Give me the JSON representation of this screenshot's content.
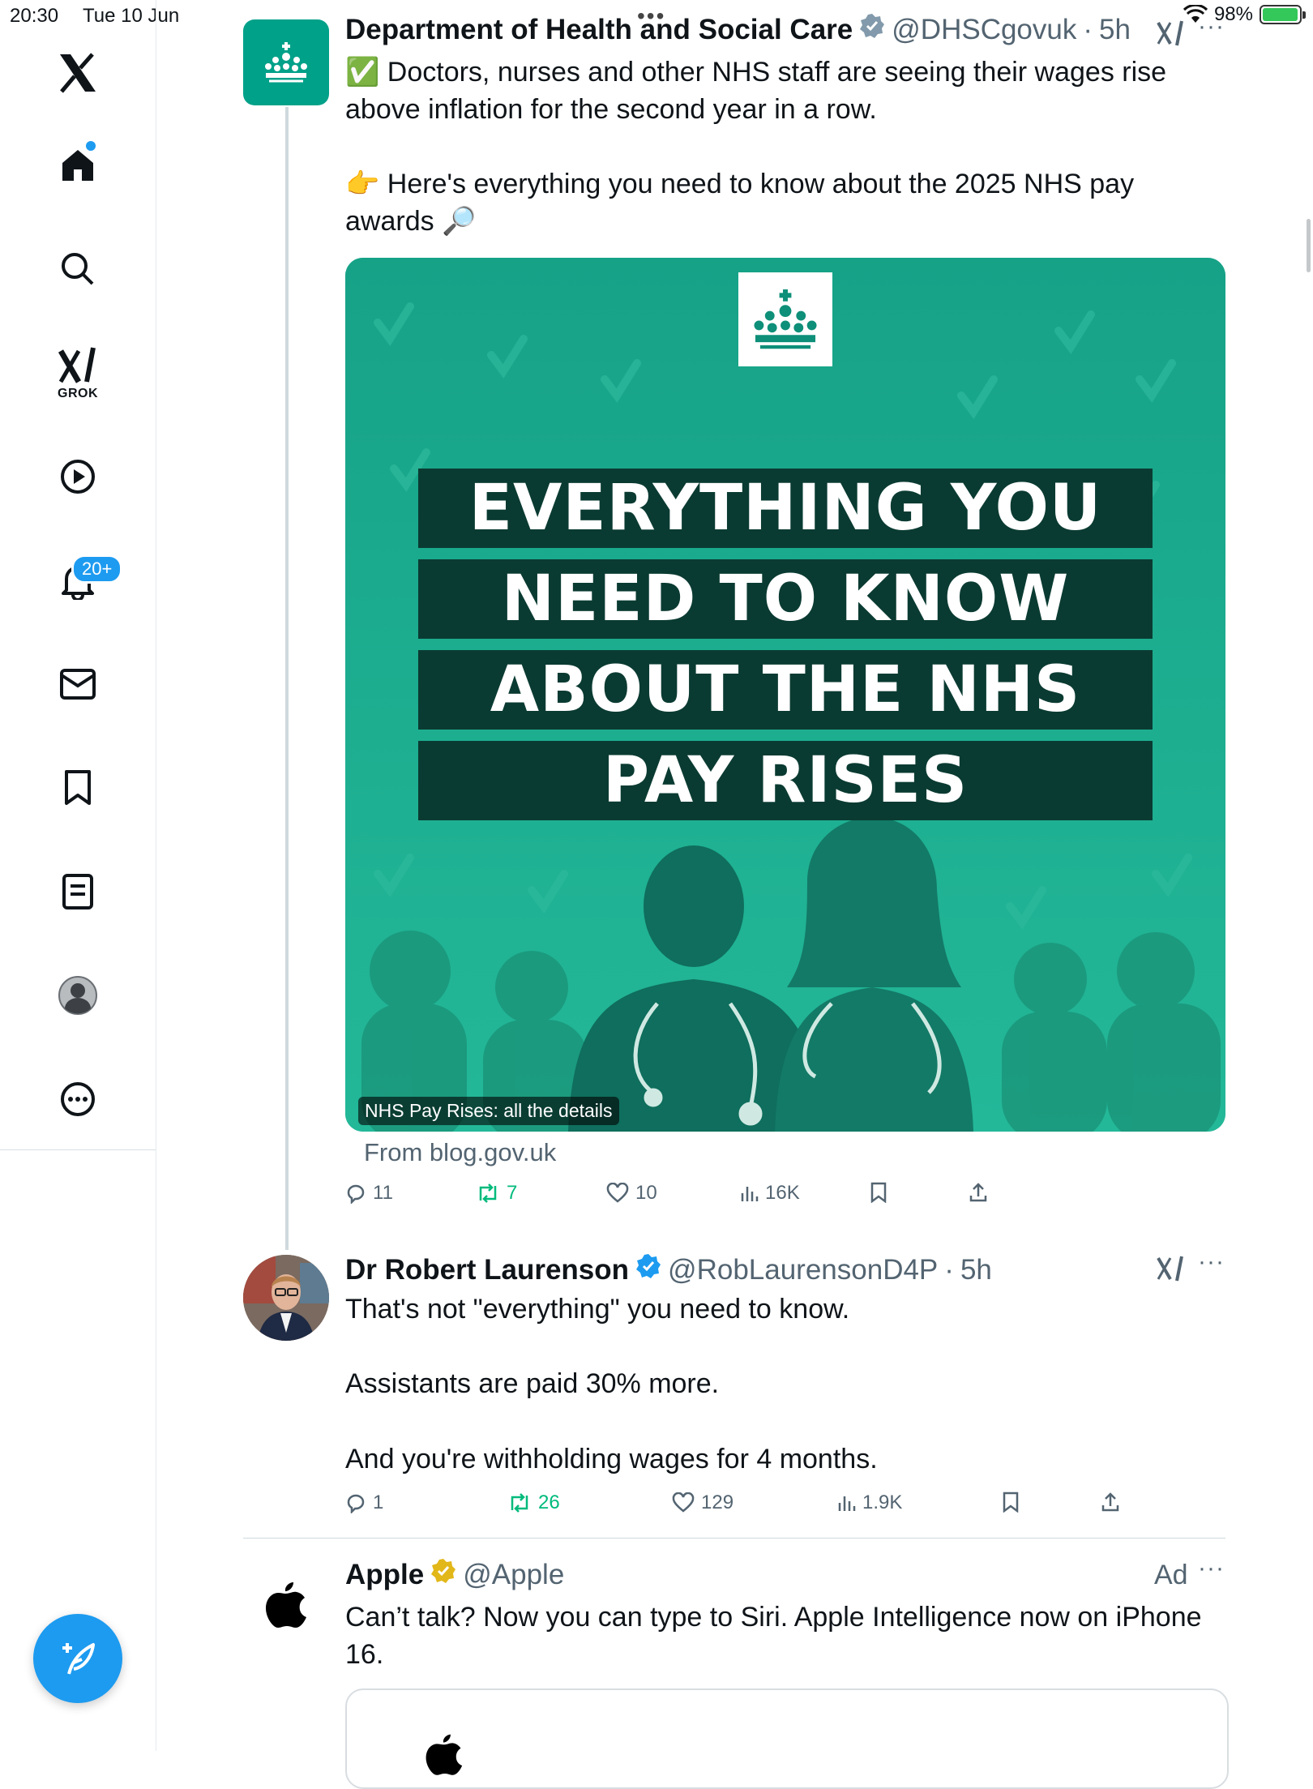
{
  "status_bar": {
    "time": "20:30",
    "date": "Tue 10 Jun",
    "battery": "98%",
    "battery_level": 0.98
  },
  "sidebar": {
    "items": [
      {
        "name": "logo",
        "icon": "x-logo-icon"
      },
      {
        "name": "home",
        "icon": "home-icon"
      },
      {
        "name": "search",
        "icon": "search-icon"
      },
      {
        "name": "grok",
        "icon": "grok-icon",
        "label": "GROK"
      },
      {
        "name": "video",
        "icon": "play-icon"
      },
      {
        "name": "notifications",
        "icon": "bell-icon",
        "badge": "20+"
      },
      {
        "name": "messages",
        "icon": "mail-icon"
      },
      {
        "name": "bookmarks",
        "icon": "bookmark-icon"
      },
      {
        "name": "lists",
        "icon": "lists-icon"
      },
      {
        "name": "profile",
        "icon": "avatar-icon"
      },
      {
        "name": "more",
        "icon": "more-icon"
      }
    ],
    "compose_icon": "compose-icon"
  },
  "tweets": [
    {
      "name": "Department of Health and Social Care",
      "handle": "@DHSCgovuk",
      "time": "5h",
      "text_line1": "✅ Doctors, nurses and other NHS staff are seeing their wages rise above inflation for the second year in a row.",
      "text_line2": "👉 Here's everything you need to know about the 2025 NHS pay awards 🔎",
      "media": {
        "headline": [
          "EVERYTHING YOU",
          "NEED TO KNOW",
          "ABOUT THE NHS",
          "PAY RISES"
        ],
        "caption": "NHS Pay Rises: all the details",
        "from": "From blog.gov.uk"
      },
      "stats": {
        "replies": "11",
        "reposts": "7",
        "likes": "10",
        "views": "16K"
      }
    },
    {
      "name": "Dr Robert Laurenson",
      "handle": "@RobLaurensonD4P",
      "time": "5h",
      "paragraphs": [
        "That's not \"everything\" you need to know.",
        "Assistants are paid 30% more.",
        "And you're withholding wages for 4 months."
      ],
      "stats": {
        "replies": "1",
        "reposts": "26",
        "likes": "129",
        "views": "1.9K"
      }
    },
    {
      "name": "Apple",
      "handle": "@Apple",
      "ad_label": "Ad",
      "text": "Can’t talk? Now you can type to Siri. Apple Intelligence now on iPhone 16."
    }
  ],
  "colors": {
    "accent": "#1d9bf0",
    "repost": "#00ba7c",
    "dhsc_green": "#00a189",
    "media_band": "#0a3b32",
    "gold_badge": "#e2b719"
  }
}
